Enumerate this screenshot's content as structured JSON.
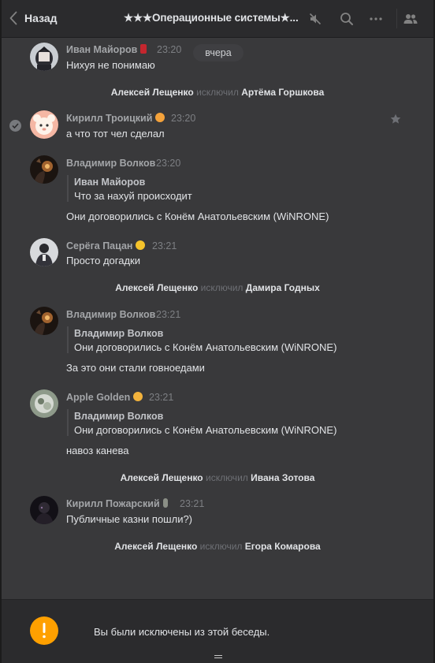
{
  "header": {
    "back_label": "Назад",
    "title": "★★★Операционные системы★...",
    "icons": [
      "back-chevron-icon",
      "muted-speaker-icon",
      "search-icon",
      "more-icon",
      "members-icon"
    ]
  },
  "date_divider": "вчера",
  "messages": [
    {
      "author": "Иван Майоров",
      "emoji": "wine-glass",
      "time": "23:20",
      "text": "Нихуя не понимаю"
    },
    {
      "author": "Кирилл Троицкий",
      "emoji": "smiling-face",
      "time": "23:20",
      "text": "а что тот чел сделал",
      "selected": true
    },
    {
      "author": "Владимир Волков",
      "time": "23:20",
      "quote": {
        "author": "Иван Майоров",
        "text": "Что за нахуй происходит"
      },
      "text": "Они договорились с Конём Анатольевским (WiNRONE)"
    },
    {
      "author": "Серёга Пацан",
      "emoji": "sunglasses-face",
      "time": "23:21",
      "text": "Просто догадки"
    },
    {
      "author": "Владимир Волков",
      "time": "23:21",
      "quote": {
        "author": "Владимир Волков",
        "text": "Они договорились с Конём Анатольевским (WiNRONE)"
      },
      "text": "За это они стали говноедами"
    },
    {
      "author": "Apple Golden",
      "emoji": "emoji-face",
      "time": "23:21",
      "quote": {
        "author": "Владимир Волков",
        "text": "Они договорились с Конём Анатольевским (WiNRONE)"
      },
      "text": "навоз канева"
    },
    {
      "author": "Кирилл Пожарский",
      "emoji": "figure",
      "time": "23:21",
      "text": "Публичные казни пошли?)"
    }
  ],
  "service_events": [
    {
      "actor": "Алексей Лещенко",
      "verb": "исключил",
      "target": "Артёма Горшкова"
    },
    {
      "actor": "Алексей Лещенко",
      "verb": "исключил",
      "target": "Дамира Годных"
    },
    {
      "actor": "Алексей Лещенко",
      "verb": "исключил",
      "target": "Ивана Зотова"
    },
    {
      "actor": "Алексей Лещенко",
      "verb": "исключил",
      "target": "Егора Комарова"
    }
  ],
  "banner": {
    "text": "Вы были исключены из этой беседы.",
    "icon": "exclamation-icon"
  },
  "colors": {
    "background": "#39393b",
    "header": "#2b2b2d",
    "author": "#a3a5a8",
    "muted": "#6e7075",
    "warning": "#ffa000"
  }
}
